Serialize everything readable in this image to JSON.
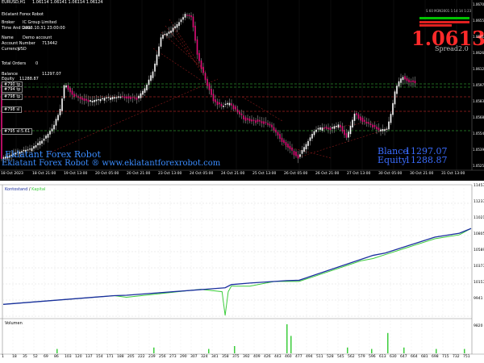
{
  "chart_header": {
    "symbol_tf": "EURUSD,H1",
    "ohlc": "1.06114 1.06141 1.06114 1.06124"
  },
  "info_panel": {
    "title": "Eklatant Forex Robot",
    "rows": [
      {
        "label": "Broker",
        "value": "IC Group Limited"
      },
      {
        "label": "Time And Date",
        "value": "2023.10.31 23:00:00"
      },
      {
        "label": "Name",
        "value": "Demo account"
      },
      {
        "label": "Account Number",
        "value": "713442"
      },
      {
        "label": "Currency",
        "value": "USD"
      },
      {
        "label": "Total Orders",
        "value": "0"
      },
      {
        "label": "Balance",
        "value": "11297.07"
      },
      {
        "label": "Equity",
        "value": "11288.87"
      }
    ]
  },
  "price_widget": {
    "time_label": "S 60 M3N3001 1:14 14 1:23",
    "price": "1.06134",
    "spread_label": "Spread",
    "spread_value": "2.0",
    "colors": {
      "bid": "#ff2a2a",
      "bar_up": "#00c000"
    }
  },
  "level_labels": [
    "#790 tp",
    "#798 tp",
    "#798 sl",
    "#795 sl:5.61",
    "#794 tp"
  ],
  "watermark": {
    "line1": "Eklatant Forex Robot",
    "line2": "Eklatant Forex Robot ® www.eklatantforexrobot.com"
  },
  "summary": {
    "balance_label": "Blance",
    "balance_value": "11297.07",
    "equity_label": "Equity",
    "equity_value": "11288.87",
    "color": "#3a6cff"
  },
  "price_axis": [
    "1.06700",
    "1.06555",
    "1.06410",
    "1.06265",
    "1.06120",
    "1.05975",
    "1.05830",
    "1.05685",
    "1.05540",
    "1.05395",
    "1.05255"
  ],
  "time_axis": [
    "18 Oct 2023",
    "18 Oct 21:00",
    "19 Oct 13:00",
    "20 Oct 05:00",
    "20 Oct 21:00",
    "23 Oct 13:00",
    "24 Oct 05:00",
    "24 Oct 21:00",
    "25 Oct 13:00",
    "26 Oct 05:00",
    "26 Oct 21:00",
    "27 Oct 13:00",
    "30 Oct 05:00",
    "30 Oct 21:00",
    "31 Oct 13:00"
  ],
  "balance_chart": {
    "legend_balance": "Kontostand",
    "legend_equity": "Kapital",
    "colors": {
      "balance": "#1a2f9e",
      "equity": "#3ccd3c"
    },
    "y_ticks": [
      "11453",
      "11237",
      "11021",
      "10805",
      "10589",
      "10373",
      "10157",
      "9941",
      "9820"
    ],
    "volume_label": "Volumen"
  },
  "chart_data": {
    "type": "line",
    "title": "",
    "series": [
      {
        "name": "Kontostand",
        "x": [
          0,
          180,
          200,
          360,
          370,
          400,
          440,
          460,
          480,
          600,
          620,
          700,
          740,
          759
        ],
        "values": [
          9970,
          10080,
          10085,
          10180,
          10220,
          10240,
          10260,
          10270,
          10275,
          10590,
          10620,
          10820,
          10870,
          10930
        ]
      },
      {
        "name": "Kapital",
        "x": [
          0,
          180,
          200,
          320,
          355,
          360,
          365,
          370,
          400,
          440,
          480,
          580,
          600,
          620,
          700,
          740,
          759
        ],
        "values": [
          9970,
          10080,
          10060,
          10160,
          10130,
          9830,
          10130,
          10200,
          10200,
          10260,
          10260,
          10520,
          10550,
          10600,
          10800,
          10850,
          10930
        ]
      }
    ],
    "x_ticks": [
      "1",
      "18",
      "35",
      "52",
      "69",
      "86",
      "103",
      "120",
      "137",
      "154",
      "171",
      "188",
      "205",
      "222",
      "239",
      "256",
      "273",
      "290",
      "307",
      "324",
      "341",
      "358",
      "375",
      "392",
      "409",
      "426",
      "443",
      "460",
      "477",
      "494",
      "511",
      "528",
      "545",
      "562",
      "579",
      "596",
      "613",
      "630",
      "647",
      "664",
      "681",
      "698",
      "715",
      "732",
      "751"
    ],
    "ylim": [
      9820,
      11453
    ]
  }
}
